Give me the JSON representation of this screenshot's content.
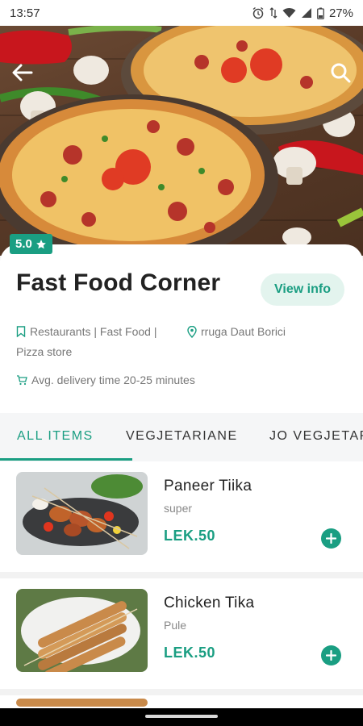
{
  "status_bar": {
    "time": "13:57",
    "battery": "27%"
  },
  "colors": {
    "accent": "#1a9e82",
    "accent_light": "#e3f4ee"
  },
  "icons": {
    "back": "arrow-left-icon",
    "search": "search-icon",
    "star": "star-icon",
    "tag": "bookmark-icon",
    "location": "location-pin-icon",
    "cart": "cart-icon",
    "add": "plus-icon"
  },
  "restaurant": {
    "rating": "5.0",
    "name": "Fast Food Corner",
    "view_info": "View info",
    "categories_line1": "Restaurants | Fast Food |",
    "categories_line2": "Pizza store",
    "address": "rruga Daut Borici",
    "delivery": "Avg. delivery time 20-25 minutes"
  },
  "tabs": [
    "ALL ITEMS",
    "VEGJETARIANE",
    "JO VEGJETARIANE"
  ],
  "items": [
    {
      "name": "Paneer Tiika",
      "desc": "super",
      "price": "LEK.50"
    },
    {
      "name": "Chicken Tika",
      "desc": "Pule",
      "price": "LEK.50"
    }
  ]
}
